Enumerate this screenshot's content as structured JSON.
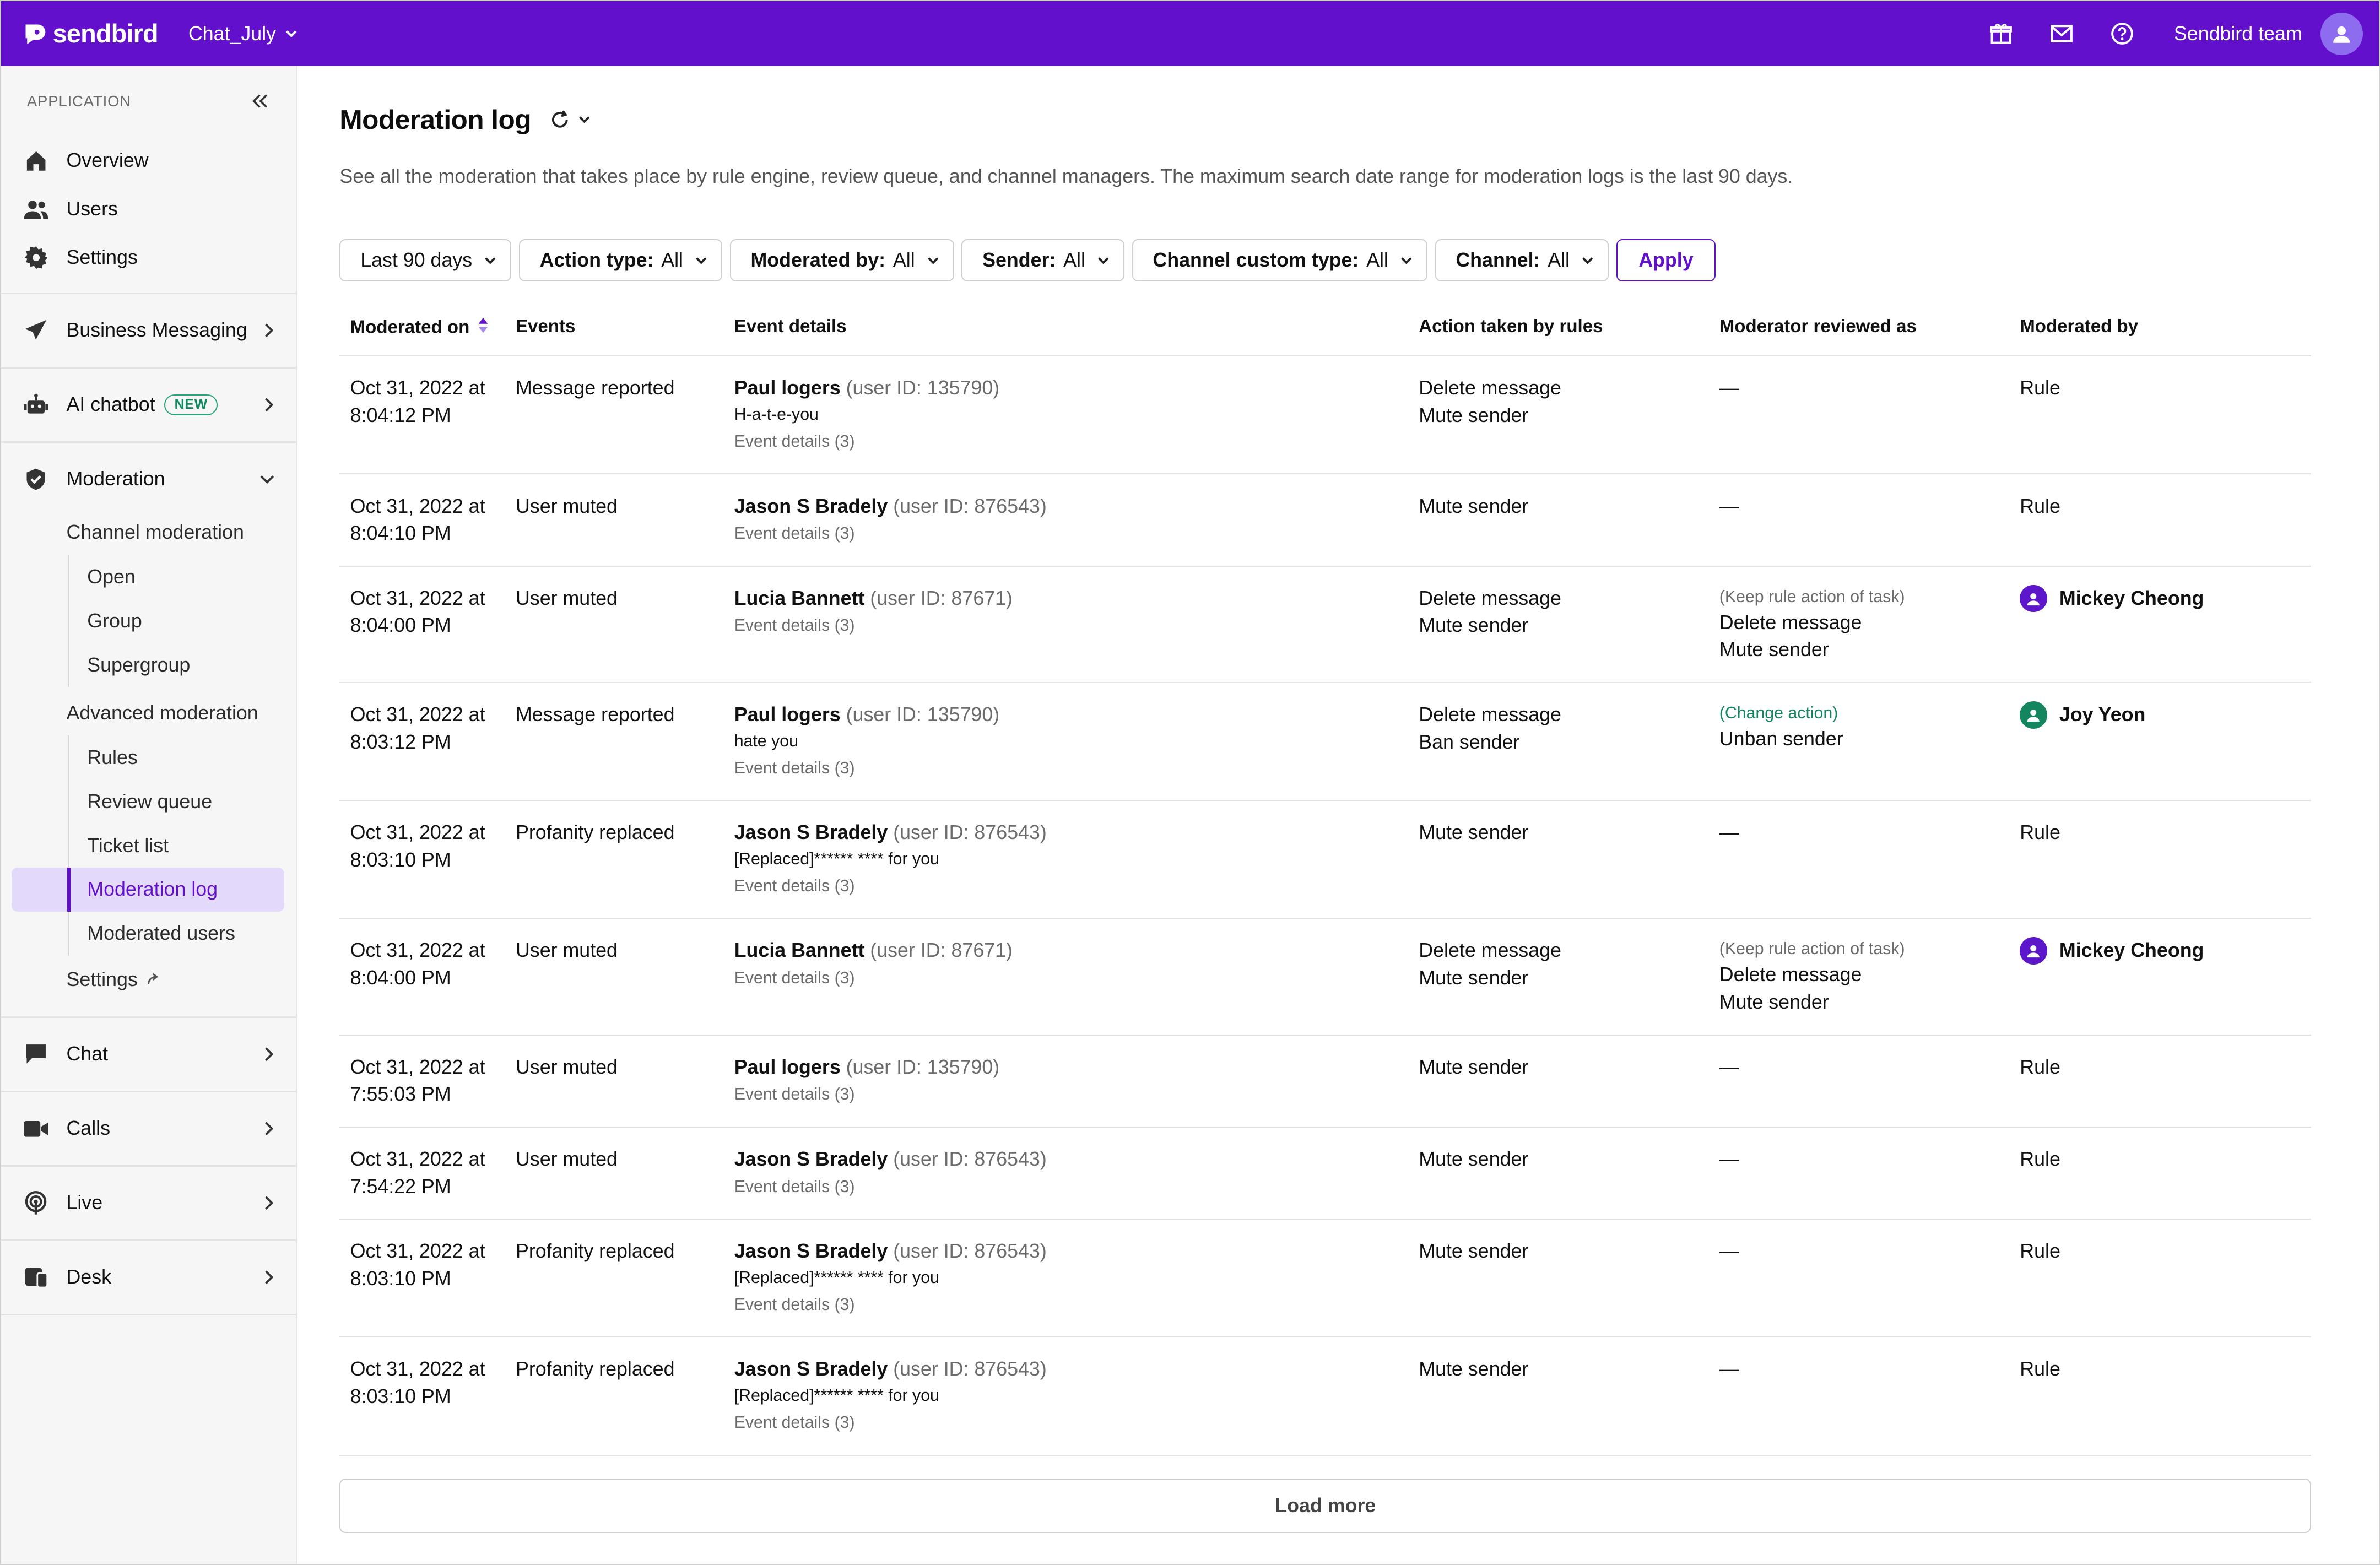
{
  "topbar": {
    "brand": "sendbird",
    "app_name": "Chat_July",
    "team": "Sendbird team",
    "icons": [
      "gift-icon",
      "mail-icon",
      "help-icon",
      "user-avatar-icon"
    ]
  },
  "sidebar": {
    "section_label": "APPLICATION",
    "top_items": [
      {
        "label": "Overview",
        "icon": "home-icon"
      },
      {
        "label": "Users",
        "icon": "users-icon"
      },
      {
        "label": "Settings",
        "icon": "gear-icon"
      }
    ],
    "business_messaging": "Business Messaging",
    "ai_chatbot": "AI chatbot",
    "ai_badge": "NEW",
    "moderation": "Moderation",
    "channel_moderation": "Channel moderation",
    "channel_items": [
      "Open",
      "Group",
      "Supergroup"
    ],
    "advanced_moderation": "Advanced moderation",
    "advanced_items": [
      "Rules",
      "Review queue",
      "Ticket list",
      "Moderation log",
      "Moderated users"
    ],
    "settings": "Settings",
    "chat": "Chat",
    "calls": "Calls",
    "live": "Live",
    "desk": "Desk"
  },
  "page": {
    "title": "Moderation log",
    "description": "See all the moderation that takes place by rule engine, review queue, and channel managers. The maximum search date range for moderation logs is the last 90 days.",
    "load_more": "Load more"
  },
  "filters": {
    "date": "Last 90 days",
    "action_type_label": "Action type:",
    "action_type_value": "All",
    "moderated_by_label": "Moderated by:",
    "moderated_by_value": "All",
    "sender_label": "Sender:",
    "sender_value": "All",
    "channel_custom_type_label": "Channel custom type:",
    "channel_custom_type_value": "All",
    "channel_label": "Channel:",
    "channel_value": "All",
    "apply": "Apply"
  },
  "table": {
    "columns": [
      "Moderated on",
      "Events",
      "Event details",
      "Action taken by rules",
      "Moderator reviewed as",
      "Moderated by"
    ],
    "rows": [
      {
        "date": "Oct 31, 2022 at",
        "time": "8:04:12 PM",
        "event": "Message reported",
        "user": "Paul logers",
        "uid": "(user ID: 135790)",
        "msg": "H-a-t-e-you",
        "details": "Event details (3)",
        "actions": [
          "Delete message",
          "Mute sender"
        ],
        "review_note": "",
        "review_note_type": "",
        "review": [
          "—"
        ],
        "moderator": "Rule",
        "mod_color": ""
      },
      {
        "date": "Oct 31, 2022 at",
        "time": "8:04:10 PM",
        "event": "User muted",
        "user": "Jason S Bradely",
        "uid": "(user ID: 876543)",
        "msg": "",
        "details": "Event details (3)",
        "actions": [
          "Mute sender"
        ],
        "review_note": "",
        "review_note_type": "",
        "review": [
          "—"
        ],
        "moderator": "Rule",
        "mod_color": ""
      },
      {
        "date": "Oct 31, 2022 at",
        "time": "8:04:00 PM",
        "event": "User muted",
        "user": "Lucia Bannett",
        "uid": "(user ID: 87671)",
        "msg": "",
        "details": "Event details (3)",
        "actions": [
          "Delete message",
          "Mute sender"
        ],
        "review_note": "(Keep rule action of task)",
        "review_note_type": "gray",
        "review": [
          "Delete message",
          "Mute sender"
        ],
        "moderator": "Mickey Cheong",
        "mod_color": "#5b17c9"
      },
      {
        "date": "Oct 31, 2022 at",
        "time": "8:03:12 PM",
        "event": "Message reported",
        "user": "Paul logers",
        "uid": "(user ID: 135790)",
        "msg": "hate you",
        "details": "Event details (3)",
        "actions": [
          "Delete message",
          "Ban sender"
        ],
        "review_note": "(Change action)",
        "review_note_type": "green",
        "review": [
          "Unban sender"
        ],
        "moderator": "Joy Yeon",
        "mod_color": "#14865f"
      },
      {
        "date": "Oct 31, 2022 at",
        "time": "8:03:10 PM",
        "event": "Profanity replaced",
        "user": "Jason S Bradely",
        "uid": "(user ID: 876543)",
        "msg": "[Replaced]****** **** for you",
        "details": "Event details (3)",
        "actions": [
          "Mute sender"
        ],
        "review_note": "",
        "review_note_type": "",
        "review": [
          "—"
        ],
        "moderator": "Rule",
        "mod_color": ""
      },
      {
        "date": "Oct 31, 2022 at",
        "time": "8:04:00 PM",
        "event": "User muted",
        "user": "Lucia Bannett",
        "uid": "(user ID: 87671)",
        "msg": "",
        "details": "Event details (3)",
        "actions": [
          "Delete message",
          "Mute sender"
        ],
        "review_note": "(Keep rule action of task)",
        "review_note_type": "gray",
        "review": [
          "Delete message",
          "Mute sender"
        ],
        "moderator": "Mickey Cheong",
        "mod_color": "#5b17c9"
      },
      {
        "date": "Oct 31, 2022 at",
        "time": "7:55:03 PM",
        "event": "User muted",
        "user": "Paul logers",
        "uid": "(user ID: 135790)",
        "msg": "",
        "details": "Event details (3)",
        "actions": [
          "Mute sender"
        ],
        "review_note": "",
        "review_note_type": "",
        "review": [
          "—"
        ],
        "moderator": "Rule",
        "mod_color": ""
      },
      {
        "date": "Oct 31, 2022 at",
        "time": "7:54:22 PM",
        "event": "User muted",
        "user": "Jason S Bradely",
        "uid": "(user ID: 876543)",
        "msg": "",
        "details": "Event details (3)",
        "actions": [
          "Mute sender"
        ],
        "review_note": "",
        "review_note_type": "",
        "review": [
          "—"
        ],
        "moderator": "Rule",
        "mod_color": ""
      },
      {
        "date": "Oct 31, 2022 at",
        "time": "8:03:10 PM",
        "event": "Profanity replaced",
        "user": "Jason S Bradely",
        "uid": "(user ID: 876543)",
        "msg": "[Replaced]****** **** for you",
        "details": "Event details (3)",
        "actions": [
          "Mute sender"
        ],
        "review_note": "",
        "review_note_type": "",
        "review": [
          "—"
        ],
        "moderator": "Rule",
        "mod_color": ""
      },
      {
        "date": "Oct 31, 2022 at",
        "time": "8:03:10 PM",
        "event": "Profanity replaced",
        "user": "Jason S Bradely",
        "uid": "(user ID: 876543)",
        "msg": "[Replaced]****** **** for you",
        "details": "Event details (3)",
        "actions": [
          "Mute sender"
        ],
        "review_note": "",
        "review_note_type": "",
        "review": [
          "—"
        ],
        "moderator": "Rule",
        "mod_color": ""
      }
    ]
  },
  "colors": {
    "brand": "#6210CC",
    "active_bg": "#e3dafb",
    "green": "#14865f"
  }
}
